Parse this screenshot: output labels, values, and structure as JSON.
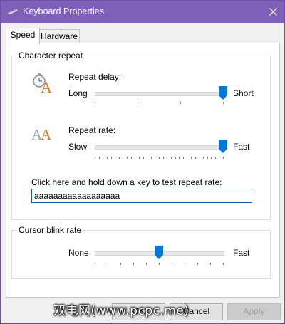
{
  "window": {
    "title": "Keyboard Properties"
  },
  "tabs": [
    {
      "label": "Speed"
    },
    {
      "label": "Hardware"
    }
  ],
  "character_repeat": {
    "group_label": "Character repeat",
    "repeat_delay": {
      "label": "Repeat delay:",
      "min_label": "Long",
      "max_label": "Short",
      "value": 4,
      "max": 4,
      "tick_count": 4
    },
    "repeat_rate": {
      "label": "Repeat rate:",
      "min_label": "Slow",
      "max_label": "Fast",
      "value": 32,
      "max": 32,
      "tick_count": 33
    },
    "test": {
      "label": "Click here and hold down a key to test repeat rate:",
      "value": "aaaaaaaaaaaaaaaaaa"
    }
  },
  "cursor_blink": {
    "group_label": "Cursor blink rate",
    "min_label": "None",
    "max_label": "Fast",
    "value": 5,
    "max": 10,
    "tick_count": 11
  },
  "buttons": {
    "ok": "OK",
    "cancel": "Cancel",
    "apply": "Apply"
  },
  "watermark": "双电网(www.pcpc.me)",
  "colors": {
    "accent": "#0078d7",
    "titlebar": "#7f60b8"
  },
  "icons": {
    "delay": "stopwatch-letter-a-icon",
    "rate": "double-letter-a-icon",
    "app": "keyboard-icon",
    "close": "close-icon"
  }
}
